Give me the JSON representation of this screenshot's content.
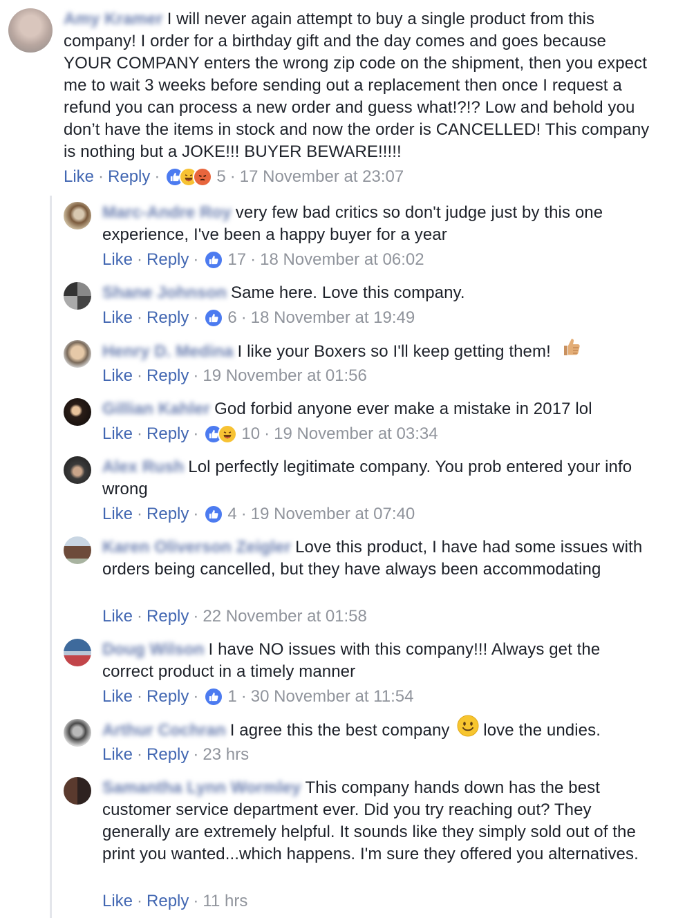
{
  "main_comment": {
    "author": "Amy Kramer",
    "text": "I will never again attempt to buy a single product from this company! I order for a birthday gift and the day comes and goes because YOUR COMPANY enters the wrong zip code on the shipment, then you expect me to wait 3 weeks before sending out a replacement then once I request a refund you can process a new order and guess what!?!? Low and behold you don’t have the items in stock and now the order is CANCELLED! This company is nothing but a JOKE!!! BUYER BEWARE!!!!!",
    "like_label": "Like",
    "reply_label": "Reply",
    "reactions": [
      "like",
      "haha",
      "angry"
    ],
    "reaction_count": "5",
    "timestamp": "17 November at 23:07"
  },
  "replies": [
    {
      "author": "Marc-Andre Roy",
      "text": "very few bad critics so don't judge just by this one experience, I've been a happy buyer for a year",
      "like_label": "Like",
      "reply_label": "Reply",
      "reactions": [
        "like"
      ],
      "reaction_count": "17",
      "timestamp": "18 November at 06:02"
    },
    {
      "author": "Shane Johnson",
      "text": "Same here. Love this company.",
      "like_label": "Like",
      "reply_label": "Reply",
      "reactions": [
        "like"
      ],
      "reaction_count": "6",
      "timestamp": "18 November at 19:49"
    },
    {
      "author": "Henry D. Medina",
      "text": "I like your Boxers so I'll keep getting them!",
      "emoji": "thumbs-up",
      "like_label": "Like",
      "reply_label": "Reply",
      "reactions": [],
      "reaction_count": "",
      "timestamp": "19 November at 01:56"
    },
    {
      "author": "Gillian Kahler",
      "text": "God forbid anyone ever make a mistake in 2017 lol",
      "like_label": "Like",
      "reply_label": "Reply",
      "reactions": [
        "like",
        "haha"
      ],
      "reaction_count": "10",
      "timestamp": "19 November at 03:34"
    },
    {
      "author": "Alex Rush",
      "text": "Lol perfectly legitimate company. You prob entered your info wrong",
      "like_label": "Like",
      "reply_label": "Reply",
      "reactions": [
        "like"
      ],
      "reaction_count": "4",
      "timestamp": "19 November at 07:40"
    },
    {
      "author": "Karen Oliverson Zeigler",
      "text": "Love this product, I have had some issues with orders being cancelled, but they have always been accommodating",
      "like_label": "Like",
      "reply_label": "Reply",
      "reactions": [],
      "reaction_count": "",
      "timestamp": "22 November at 01:58"
    },
    {
      "author": "Doug Wilson",
      "text": "I have NO issues with this company!!! Always get the correct product in a timely manner",
      "like_label": "Like",
      "reply_label": "Reply",
      "reactions": [
        "like"
      ],
      "reaction_count": "1",
      "timestamp": "30 November at 11:54"
    },
    {
      "author": "Arthur Cochran",
      "text_before": "I agree this the best company",
      "text_after": "love the undies.",
      "emoji": "smile",
      "like_label": "Like",
      "reply_label": "Reply",
      "reactions": [],
      "reaction_count": "",
      "timestamp": "23 hrs"
    },
    {
      "author": "Samantha Lynn Wormley",
      "text": "This company hands down has the best customer service department ever. Did you try reaching out? They generally are extremely helpful. It sounds like they simply sold out of the print you wanted...which happens. I'm sure they offered you alternatives.",
      "like_label": "Like",
      "reply_label": "Reply",
      "reactions": [],
      "reaction_count": "",
      "timestamp": "11 hrs"
    }
  ],
  "colors": {
    "link": "#4267b2",
    "meta": "#90949c",
    "text": "#1d2129",
    "like_reaction": "#4c7bf0",
    "haha_reaction": "#f7c233",
    "angry_reaction": "#e8663d"
  },
  "separator": "·"
}
